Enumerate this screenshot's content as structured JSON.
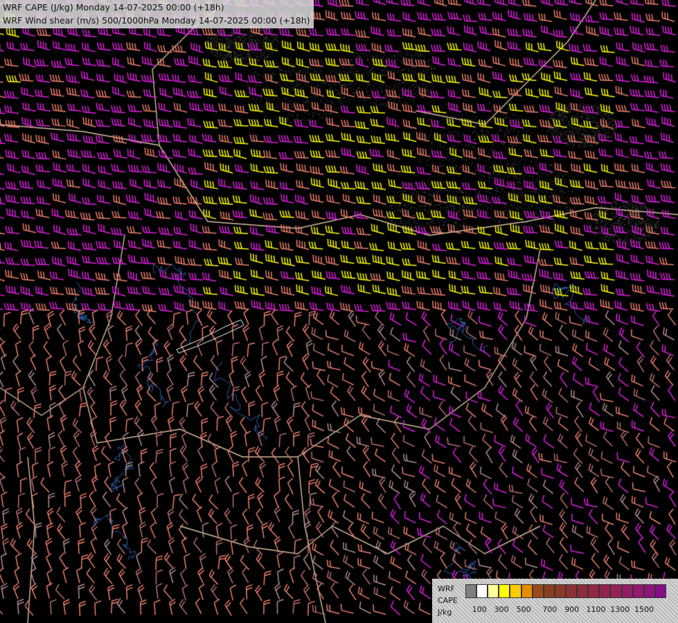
{
  "title": {
    "line1": "WRF CAPE (J/kg) Monday 14-07-2025 00:00 (+18h)",
    "line2": "WRF Wind shear (m/s) 500/1000hPa Monday 14-07-2025 00:00 (+18h)"
  },
  "legend": {
    "label_line1": "WRF",
    "label_line2": "CAPE",
    "label_line3": "J/kg",
    "colors": [
      "#7f7f7f",
      "#ffffff",
      "#ffff99",
      "#ffff00",
      "#ffcc00",
      "#e68a00",
      "#9c4a1a",
      "#8a3f1f",
      "#8b3a2a",
      "#8d3232",
      "#8f2b3a",
      "#912744",
      "#93234e",
      "#952058",
      "#951c64",
      "#951870",
      "#8f147c",
      "#870d87"
    ],
    "ticks": [
      {
        "label": "100",
        "pos": 0.07
      },
      {
        "label": "300",
        "pos": 0.18
      },
      {
        "label": "500",
        "pos": 0.29
      },
      {
        "label": "700",
        "pos": 0.42
      },
      {
        "label": "900",
        "pos": 0.53
      },
      {
        "label": "1100",
        "pos": 0.65
      },
      {
        "label": "1300",
        "pos": 0.77
      },
      {
        "label": "1500",
        "pos": 0.89
      }
    ]
  },
  "barb_colors": {
    "magenta": "#e020e0",
    "yellow": "#ffff00",
    "salmon": "#f08070",
    "rose": "#c07070",
    "tan": "#b89090"
  }
}
